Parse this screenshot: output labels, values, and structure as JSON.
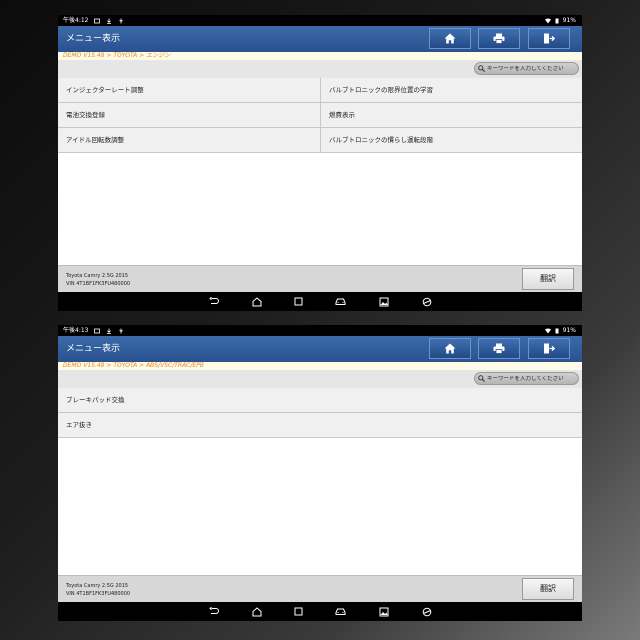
{
  "screens": [
    {
      "status": {
        "time": "午後4:12",
        "battery": "91%"
      },
      "header": {
        "title": "メニュー表示"
      },
      "breadcrumb": "DEMO V15.48 > TOYOTA > エンジン",
      "search": {
        "placeholder": "キーワードを入力してください"
      },
      "items": [
        "インジェクターレート調整",
        "バルブトロニックの限界位置の学習",
        "電池交換登録",
        "燃費表示",
        "アイドル回転数調整",
        "バルブトロニックの慣らし運転段階"
      ],
      "vehicle": {
        "model": "Toyota Camry 2.5G 2015",
        "vin": "VIN 4T1BF1FK3FU480000"
      },
      "translate_label": "翻訳"
    },
    {
      "status": {
        "time": "午後4:13",
        "battery": "91%"
      },
      "header": {
        "title": "メニュー表示"
      },
      "breadcrumb": "DEMO V15.48 > TOYOTA > ABS/VSC/TRAC/EPB",
      "search": {
        "placeholder": "キーワードを入力してください"
      },
      "items": [
        "ブレーキパッド交換",
        "エア抜き"
      ],
      "vehicle": {
        "model": "Toyota Camry 2.5G 2015",
        "vin": "VIN 4T1BF1FK3FU480000"
      },
      "translate_label": "翻訳"
    }
  ],
  "icons": {
    "home": "home-icon",
    "print": "printer-icon",
    "exit": "exit-icon",
    "search": "search-icon",
    "nav": [
      "back-icon",
      "home-icon",
      "recents-icon",
      "car-icon",
      "gallery-icon",
      "browser-icon"
    ]
  },
  "colors": {
    "header": "#2f5a99",
    "breadcrumb_text": "#e08a30",
    "breadcrumb_bg": "#fffbe6"
  }
}
